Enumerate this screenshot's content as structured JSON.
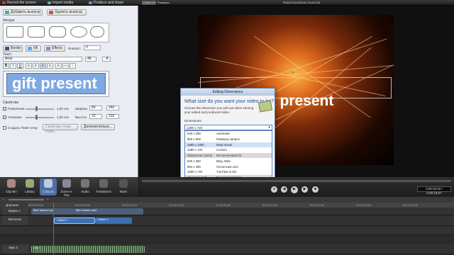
{
  "topbar": {
    "record_label": "Record the screen",
    "import_label": "Import media",
    "produce_label": "Produce and share",
    "window_title": "Редактирование выноски",
    "zoom_label": "1280x720",
    "sizes_label": "Размеры"
  },
  "left_panel": {
    "add_callout_label": "Добавить выноску",
    "remove_callout_label": "Удалить выноску",
    "shape_group_label": "Фигура",
    "border_label": "Border",
    "fill_label": "Fill",
    "effects_label": "Effects",
    "rotation_label": "Rotation:",
    "rotation_value": "0",
    "text_group_label": "Текст",
    "font_value": "Arial",
    "font_size_value": "48",
    "preview_text": "gift present",
    "props_group_label": "Свойства",
    "fade_in_label": "Появление:",
    "fade_in_value": "1,00 сек",
    "fade_out_label": "Угасание:",
    "fade_out_value": "1,00 сек",
    "width_label": "Ширина:",
    "width_value": "240",
    "height_label": "Высота:",
    "height_value": "310",
    "x_value": "80",
    "y_value": "10",
    "flash_label": "Создать Flash-точку",
    "flash_props_label": "Свойства точки Flash...",
    "advanced_label": "Дополнительно..."
  },
  "preview": {
    "caption_text": "gift present"
  },
  "dialog": {
    "title": "Editing Dimensions",
    "question": "What size do you want your video to be?",
    "description": "Choose the dimension you will use when sharing your edited and produced video.",
    "dimensions_label": "Dimensions:",
    "selected_value": "1280 x 720",
    "rows": [
      {
        "size": "640 x 480",
        "desc": "Automatic",
        "kind": "item"
      },
      {
        "size": "800 x 600",
        "desc": "Размеры записи",
        "kind": "item"
      },
      {
        "size": "1680 x 1050",
        "desc": "Most recent",
        "kind": "sel"
      },
      {
        "size": "1280 x 720",
        "desc": "Custom",
        "kind": "item"
      },
      {
        "size": "Widescreen (16:9)",
        "desc": "Recommended for",
        "kind": "hdr"
      },
      {
        "size": "640 x 360",
        "desc": "Blog, Web",
        "kind": "item"
      },
      {
        "size": "854 x 480",
        "desc": "Screencast.com",
        "kind": "item"
      },
      {
        "size": "1280 x 720",
        "desc": "YouTube & HD",
        "kind": "item"
      },
      {
        "size": "Standard (4:3)",
        "desc": "Recommended for",
        "kind": "hdr"
      },
      {
        "size": "480 x 360",
        "desc": "Blackberry",
        "kind": "item"
      },
      {
        "size": "640 x 480",
        "desc": "Web",
        "kind": "item"
      },
      {
        "size": "800 x 600",
        "desc": "Full screen viewing",
        "kind": "item"
      },
      {
        "size": "Other",
        "desc": "Recommended for",
        "kind": "hdr"
      },
      {
        "size": "480 x 320 (3:2)",
        "desc": "iPhone/iPod Touch",
        "kind": "item"
      },
      {
        "size": "720 x 480 (3:2)",
        "desc": "DVD-Ready (NTSC)",
        "kind": "item"
      },
      {
        "size": "720 x 576 (5:4)",
        "desc": "DVD-Ready (PAL)",
        "kind": "item"
      }
    ]
  },
  "tools": {
    "clip_bin": "Clip Bin",
    "library": "Library",
    "callouts": "Callouts",
    "zoom_pan": "Zoom-n-Pan",
    "audio": "Audio",
    "transitions": "Transitions",
    "more": "More"
  },
  "playback": {
    "timecode": "0:00:02;00 / 0:00:19;07"
  },
  "timeline": {
    "tracks_label": "Дорожки",
    "ticks": [
      "00:00:00;00",
      "00:00:05;00",
      "00:00:10;00",
      "00:00:15;00",
      "00:00:20;00",
      "00:00:25;00",
      "00:00:30;00",
      "00:00:35;00",
      "00:00:40;00"
    ],
    "track_video": "Видео 1",
    "track_callouts": "Выноски",
    "track_audio": "Звук 2",
    "clip_fiber1": "fiber waves.mp4",
    "clip_fiber2": "fiber waves.mp4",
    "clip_callout1": "Callout 1",
    "clip_callout2": "Callout 1",
    "clip_audio": "Clip 1"
  },
  "colors": {
    "accent": "#4f6fa8",
    "dialog_border": "#6b7f9e",
    "clip_video": "#4e5f7a",
    "clip_callout": "#3f6fb0"
  }
}
